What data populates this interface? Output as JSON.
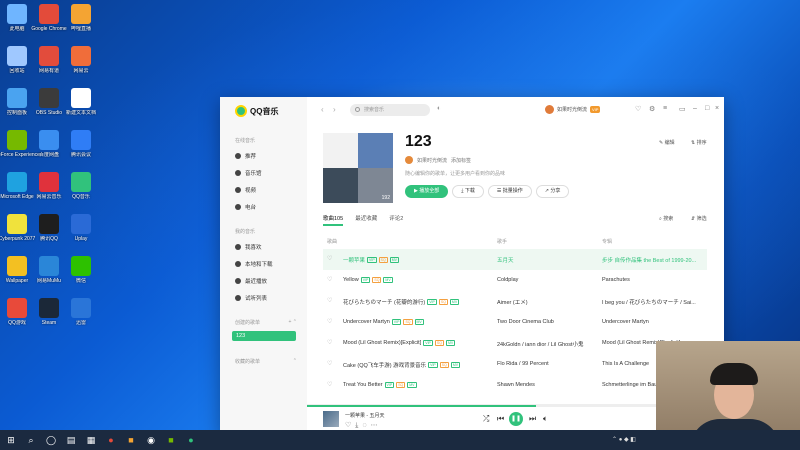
{
  "desktop": {
    "icons": [
      {
        "label": "此电脑",
        "color": "#6fb5ff"
      },
      {
        "label": "Google Chrome",
        "color": "#e34b3a"
      },
      {
        "label": "哔哩直播",
        "color": "#f4a433"
      },
      {
        "label": "回收站",
        "color": "#9fc8ff"
      },
      {
        "label": "网易有道",
        "color": "#e24c3c"
      },
      {
        "label": "网易云",
        "color": "#f06d3a"
      },
      {
        "label": "控制面板",
        "color": "#4aa3f0"
      },
      {
        "label": "OBS Studio",
        "color": "#3b3b3b"
      },
      {
        "label": "新建文本文档",
        "color": "#ffffff"
      },
      {
        "label": "GeForce Experience",
        "color": "#76b900"
      },
      {
        "label": "百度网盘",
        "color": "#3a8ef0"
      },
      {
        "label": "腾讯会议",
        "color": "#2f7df6"
      },
      {
        "label": "Microsoft Edge",
        "color": "#1fa2e0"
      },
      {
        "label": "网易云音乐",
        "color": "#e0323c"
      },
      {
        "label": "QQ音乐",
        "color": "#31c27c"
      },
      {
        "label": "Cyberpunk 2077",
        "color": "#f0e23c"
      },
      {
        "label": "腾讯QQ",
        "color": "#1e1e1e"
      },
      {
        "label": "Uplay",
        "color": "#2a6ad6"
      },
      {
        "label": "Wallpaper",
        "color": "#f3c022"
      },
      {
        "label": "网易MuMu",
        "color": "#2a86d8"
      },
      {
        "label": "微信",
        "color": "#2dc100"
      },
      {
        "label": "QQ游戏",
        "color": "#e84a3a"
      },
      {
        "label": "Steam",
        "color": "#1b2838"
      },
      {
        "label": "迅雷",
        "color": "#2a75d8"
      }
    ]
  },
  "app": {
    "logo_text": "QQ音乐",
    "search_placeholder": "搜索音乐",
    "user_name": "如果时光倒流",
    "vip_badge": "VIP",
    "sidebar": {
      "online_title": "在线音乐",
      "online_items": [
        "推荐",
        "音乐馆",
        "视频",
        "电台"
      ],
      "my_title": "我的音乐",
      "my_items": [
        "我喜欢",
        "本地和下载",
        "最近播放",
        "试听列表"
      ],
      "created_title": "创建的歌单",
      "created_active": "123",
      "collected_title": "收藏的歌单"
    },
    "playlist": {
      "title": "123",
      "owner": "如果时光倒流",
      "add_tag": "添加标签",
      "description": "随心编辑你的歌单，让更多用户看到你的品味",
      "cover_colors": [
        "#f2f2f2",
        "#5b7fb5",
        "#3c4b5a",
        "#7e8794"
      ],
      "cover_count": "192",
      "buttons": {
        "play_all": "播放全部",
        "download": "下载",
        "batch": "批量操作",
        "share": "分享"
      },
      "edit": "编辑",
      "sort": "排序",
      "search": "搜索",
      "filter": "筛选"
    },
    "tabs": [
      {
        "label": "歌曲105",
        "active": true
      },
      {
        "label": "最近收藏",
        "active": false
      },
      {
        "label": "评论2",
        "active": false
      }
    ],
    "table": {
      "headers": {
        "song": "歌曲",
        "artist": "歌手",
        "album": "专辑"
      },
      "rows": [
        {
          "song": "一颗苹果",
          "artist": "五月天",
          "album": "步步 自传作品集 the Best of 1999-20...",
          "playing": true
        },
        {
          "song": "Yellow",
          "artist": "Coldplay",
          "album": "Parachutes",
          "playing": false
        },
        {
          "song": "花びらたちのマーチ (花瓣的游行)",
          "artist": "Aimer (エメ)",
          "album": "I beg you / 花びらたちのマーチ / Sai...",
          "playing": false
        },
        {
          "song": "Undercover Martyn",
          "artist": "Two Door Cinema Club",
          "album": "Undercover Martyn",
          "playing": false
        },
        {
          "song": "Mood (Lil Ghost Remix)[Explicit]",
          "artist": "24kGoldn / iann dior / Lil Ghost小鬼",
          "album": "Mood (Lil Ghost Remix)[Explicit]",
          "playing": false
        },
        {
          "song": "Cake (QQ飞车手游) 游戏背景音乐",
          "artist": "Flo Rida / 99 Percent",
          "album": "This Is A Challenge",
          "playing": false
        },
        {
          "song": "Treat You Better",
          "artist": "Shawn Mendes",
          "album": "Schmetterlinge im Bauch",
          "playing": false
        }
      ]
    },
    "player": {
      "now_playing": "一颗苹果 - 五月天",
      "progress": 0.55
    }
  },
  "taskbar": {
    "time": "10:00"
  }
}
